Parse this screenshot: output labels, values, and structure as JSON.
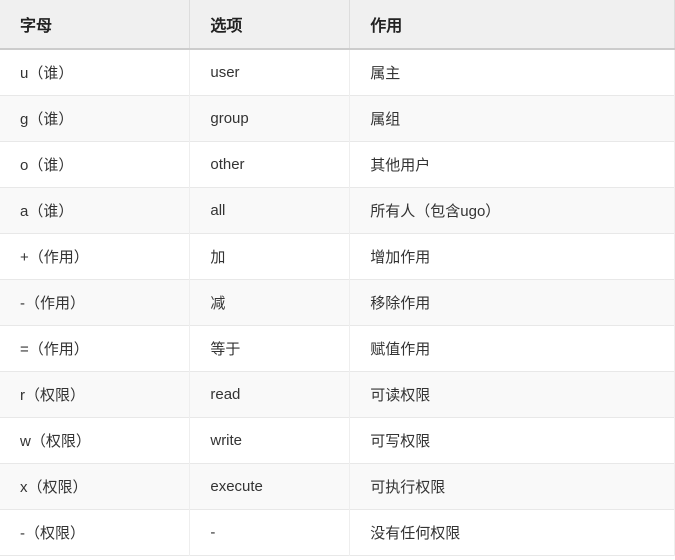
{
  "table": {
    "headers": [
      "字母",
      "选项",
      "作用"
    ],
    "rows": [
      {
        "letter": "u（谁）",
        "option": "user",
        "role": "属主"
      },
      {
        "letter": "g（谁）",
        "option": "group",
        "role": "属组"
      },
      {
        "letter": "o（谁）",
        "option": "other",
        "role": "其他用户"
      },
      {
        "letter": "a（谁）",
        "option": "all",
        "role": "所有人（包含ugo）"
      },
      {
        "letter": "+（作用）",
        "option": "加",
        "role": "增加作用"
      },
      {
        "letter": "-（作用）",
        "option": "减",
        "role": "移除作用"
      },
      {
        "letter": "=（作用）",
        "option": "等于",
        "role": "赋值作用"
      },
      {
        "letter": "r（权限）",
        "option": "read",
        "role": "可读权限"
      },
      {
        "letter": "w（权限）",
        "option": "write",
        "role": "可写权限"
      },
      {
        "letter": "x（权限）",
        "option": "execute",
        "role": "可执行权限"
      },
      {
        "letter": "-（权限）",
        "option": "-",
        "role": "没有任何权限"
      }
    ]
  }
}
